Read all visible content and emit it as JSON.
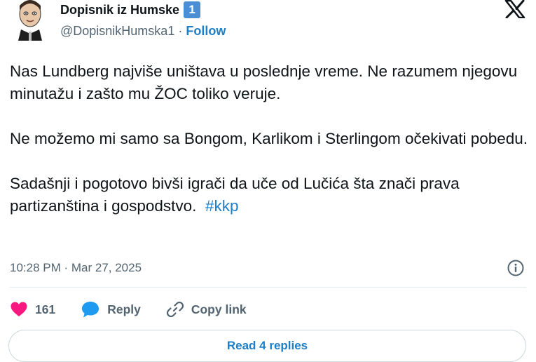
{
  "author": {
    "display_name": "Dopisnik iz Humske",
    "badge": "1",
    "handle": "@DopisnikHumska1",
    "separator": "·",
    "follow_label": "Follow"
  },
  "tweet": {
    "paragraphs": [
      "Nas Lundberg najviše uništava u poslednje vreme. Ne razumem njegovu minutažu i zašto mu ŽOC toliko veruje.",
      "Ne možemo mi samo sa Bongom, Karlikom i Sterlingom očekivati pobedu.",
      "Sadašnji i pogotovo bivši igrači da uče od Lučića šta znači prava partizanština i gospodstvo."
    ],
    "hashtag": "#kkp",
    "timestamp": "10:28 PM · Mar 27, 2025"
  },
  "actions": {
    "like_count": "161",
    "reply_label": "Reply",
    "copy_link_label": "Copy link"
  },
  "read_replies_label": "Read 4 replies",
  "icons": {
    "brand": "x-logo-icon",
    "like": "heart-icon",
    "reply": "speech-bubble-icon",
    "copy": "link-icon",
    "info": "info-icon"
  },
  "colors": {
    "accent": "#1d7fc8",
    "like": "#f91880",
    "secondary_text": "#536471",
    "badge": "#4a8fd6"
  }
}
